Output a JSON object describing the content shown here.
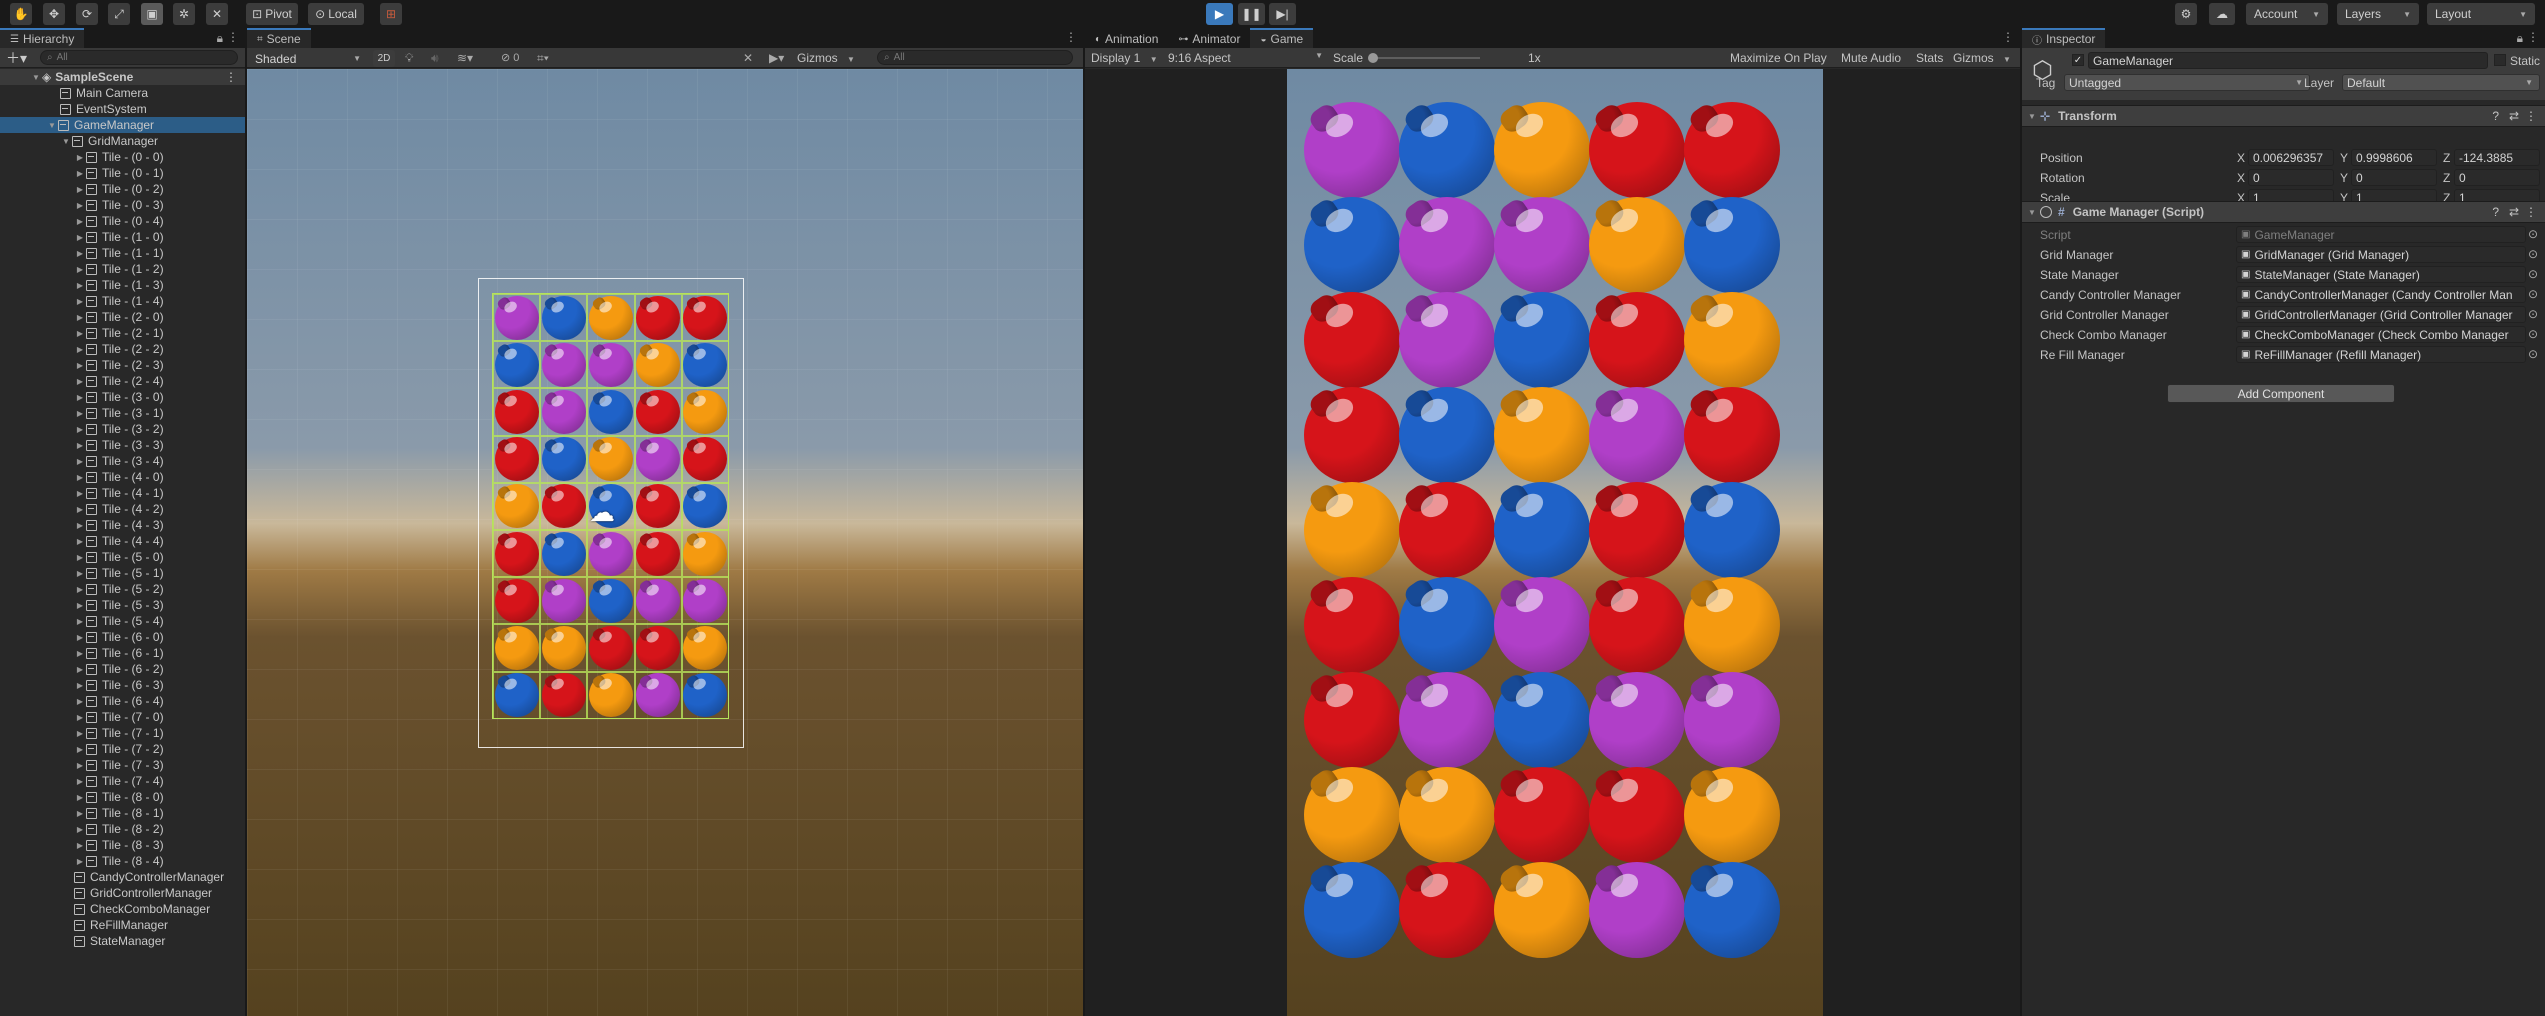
{
  "toolbar": {
    "pivot_label": "Pivot",
    "local_label": "Local",
    "account_label": "Account",
    "layers_label": "Layers",
    "layout_label": "Layout"
  },
  "hierarchy": {
    "tab": "Hierarchy",
    "search_placeholder": "All",
    "scene": "SampleScene",
    "root_items": [
      "Main Camera",
      "EventSystem",
      "GameManager"
    ],
    "grid_manager": "GridManager",
    "tiles": [
      "Tile - (0 - 0)",
      "Tile - (0 - 1)",
      "Tile - (0 - 2)",
      "Tile - (0 - 3)",
      "Tile - (0 - 4)",
      "Tile - (1 - 0)",
      "Tile - (1 - 1)",
      "Tile - (1 - 2)",
      "Tile - (1 - 3)",
      "Tile - (1 - 4)",
      "Tile - (2 - 0)",
      "Tile - (2 - 1)",
      "Tile - (2 - 2)",
      "Tile - (2 - 3)",
      "Tile - (2 - 4)",
      "Tile - (3 - 0)",
      "Tile - (3 - 1)",
      "Tile - (3 - 2)",
      "Tile - (3 - 3)",
      "Tile - (3 - 4)",
      "Tile - (4 - 0)",
      "Tile - (4 - 1)",
      "Tile - (4 - 2)",
      "Tile - (4 - 3)",
      "Tile - (4 - 4)",
      "Tile - (5 - 0)",
      "Tile - (5 - 1)",
      "Tile - (5 - 2)",
      "Tile - (5 - 3)",
      "Tile - (5 - 4)",
      "Tile - (6 - 0)",
      "Tile - (6 - 1)",
      "Tile - (6 - 2)",
      "Tile - (6 - 3)",
      "Tile - (6 - 4)",
      "Tile - (7 - 0)",
      "Tile - (7 - 1)",
      "Tile - (7 - 2)",
      "Tile - (7 - 3)",
      "Tile - (7 - 4)",
      "Tile - (8 - 0)",
      "Tile - (8 - 1)",
      "Tile - (8 - 2)",
      "Tile - (8 - 3)",
      "Tile - (8 - 4)"
    ],
    "managers": [
      "CandyControllerManager",
      "GridControllerManager",
      "CheckComboManager",
      "ReFillManager",
      "StateManager"
    ]
  },
  "scene": {
    "tab": "Scene",
    "shading": "Shaded",
    "mode_2d": "2D",
    "hidden_count": "0",
    "gizmos": "Gizmos",
    "search_placeholder": "All"
  },
  "game": {
    "tabs": [
      "Animation",
      "Animator",
      "Game"
    ],
    "display": "Display 1",
    "aspect": "9:16 Aspect",
    "scale_label": "Scale",
    "scale_value": "1x",
    "maximize": "Maximize On Play",
    "mute": "Mute Audio",
    "stats": "Stats",
    "gizmos": "Gizmos"
  },
  "board": {
    "rows": [
      [
        "purple",
        "blue",
        "orange",
        "red",
        "red"
      ],
      [
        "blue",
        "purple",
        "purple",
        "orange",
        "blue"
      ],
      [
        "red",
        "purple",
        "blue",
        "red",
        "orange"
      ],
      [
        "red",
        "blue",
        "orange",
        "purple",
        "red"
      ],
      [
        "orange",
        "red",
        "blue",
        "red",
        "blue"
      ],
      [
        "red",
        "blue",
        "purple",
        "red",
        "orange"
      ],
      [
        "red",
        "purple",
        "blue",
        "purple",
        "purple"
      ],
      [
        "orange",
        "orange",
        "red",
        "red",
        "orange"
      ],
      [
        "blue",
        "red",
        "orange",
        "purple",
        "blue"
      ]
    ],
    "colors": {
      "purple": "#b03fc8",
      "blue": "#1f62c8",
      "orange": "#f59a10",
      "red": "#d6141a"
    }
  },
  "inspector": {
    "tab": "Inspector",
    "object_name": "GameManager",
    "static_label": "Static",
    "tag_label": "Tag",
    "tag_value": "Untagged",
    "layer_label": "Layer",
    "layer_value": "Default",
    "transform": {
      "title": "Transform",
      "position_label": "Position",
      "rotation_label": "Rotation",
      "scale_label": "Scale",
      "position": {
        "x": "0.006296357",
        "y": "0.9998606",
        "z": "-124.3885"
      },
      "rotation": {
        "x": "0",
        "y": "0",
        "z": "0"
      },
      "scale": {
        "x": "1",
        "y": "1",
        "z": "1"
      }
    },
    "script_component": {
      "title": "Game Manager (Script)",
      "fields": [
        {
          "label": "Script",
          "value": "GameManager"
        },
        {
          "label": "Grid Manager",
          "value": "GridManager (Grid Manager)"
        },
        {
          "label": "State Manager",
          "value": "StateManager (State Manager)"
        },
        {
          "label": "Candy Controller Manager",
          "value": "CandyControllerManager (Candy Controller Man"
        },
        {
          "label": "Grid Controller Manager",
          "value": "GridControllerManager (Grid Controller Manager"
        },
        {
          "label": "Check Combo Manager",
          "value": "CheckComboManager (Check Combo Manager"
        },
        {
          "label": "Re Fill Manager",
          "value": "ReFillManager (Refill Manager)"
        }
      ]
    },
    "add_component": "Add Component"
  }
}
